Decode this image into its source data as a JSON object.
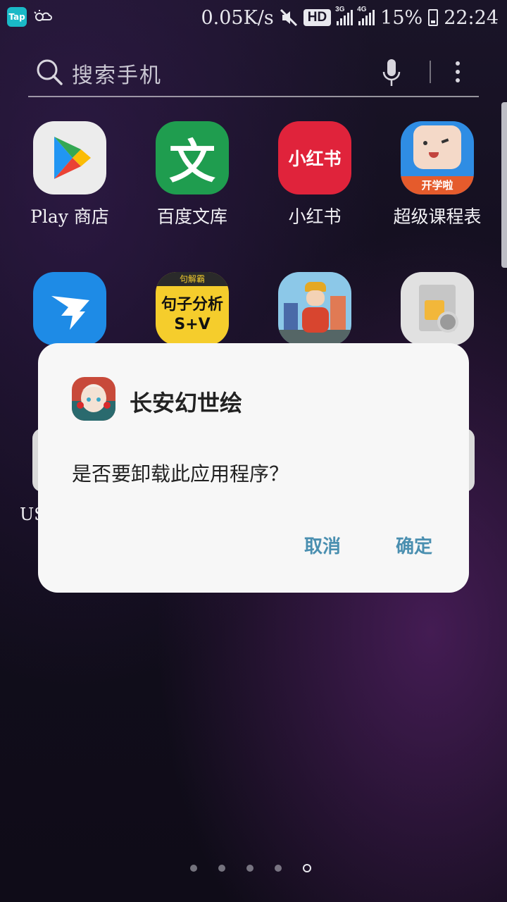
{
  "status_bar": {
    "tap_label": "Tap",
    "net_speed": "0.05K/s",
    "hd_label": "HD",
    "sim1_label": "3G",
    "sim2_label": "4G",
    "battery": "15%",
    "time": "22:24"
  },
  "search": {
    "placeholder": "搜索手机"
  },
  "apps_row1": [
    {
      "label": "Play 商店",
      "icon": "play-store-icon"
    },
    {
      "label": "百度文库",
      "icon": "baidu-wenku-icon",
      "glyph": "文"
    },
    {
      "label": "小红书",
      "icon": "xiaohongshu-icon",
      "glyph": "小红书"
    },
    {
      "label": "超级课程表",
      "icon": "super-schedule-icon",
      "badge": "开学啦"
    }
  ],
  "apps_row2": [
    {
      "icon": "dingtalk-icon"
    },
    {
      "icon": "juzi-fenxi-icon",
      "top_text": "句解霸",
      "glyph": "句子分析",
      "sub": "S+V"
    },
    {
      "icon": "delivery-icon"
    },
    {
      "icon": "sim-toolkit-icon"
    }
  ],
  "partial_label": "US",
  "dialog": {
    "title": "长安幻世绘",
    "message": "是否要卸载此应用程序？",
    "cancel": "取消",
    "confirm": "确定"
  },
  "page_indicator": {
    "count": 5,
    "active": 5
  },
  "colors": {
    "dialog_button": "#4a8fb0",
    "tap_badge": "#1ab9c7"
  }
}
